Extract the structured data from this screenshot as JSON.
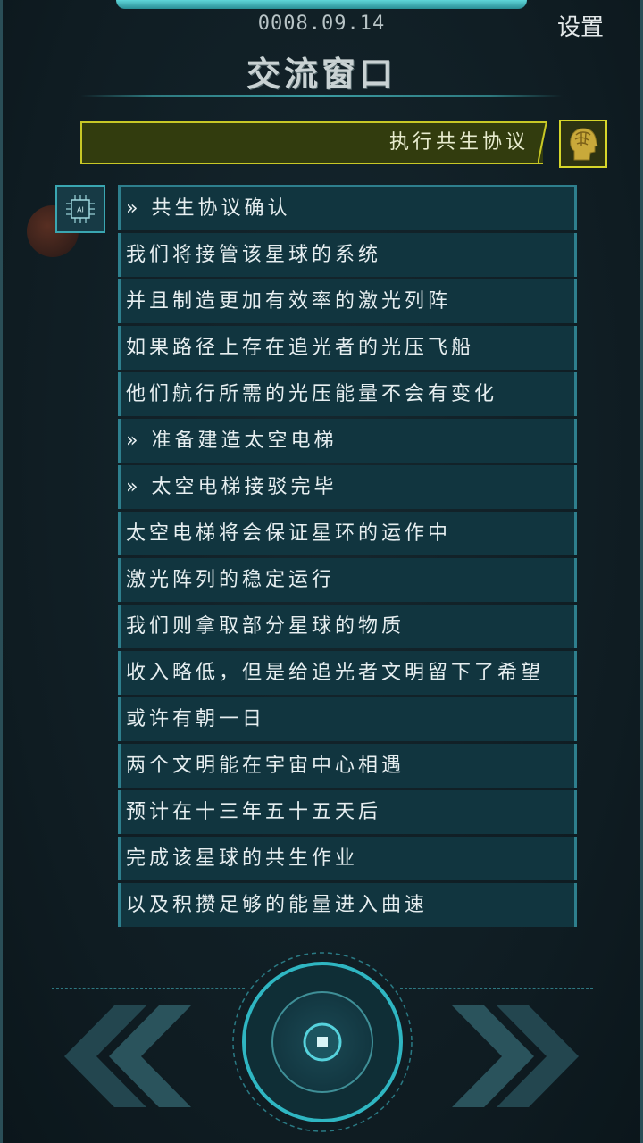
{
  "header": {
    "date": "0008.09.14",
    "settings_label": "设置",
    "title": "交流窗口"
  },
  "player_message": "执行共生协议",
  "ai_avatar_label": "AI",
  "messages": [
    "» 共生协议确认",
    "我们将接管该星球的系统",
    "并且制造更加有效率的激光列阵",
    "如果路径上存在追光者的光压飞船",
    "他们航行所需的光压能量不会有变化",
    "» 准备建造太空电梯",
    "» 太空电梯接驳完毕",
    "太空电梯将会保证星环的运作中",
    "激光阵列的稳定运行",
    "我们则拿取部分星球的物质",
    "收入略低，但是给追光者文明留下了希望",
    "或许有朝一日",
    "两个文明能在宇宙中心相遇",
    "预计在十三年五十五天后",
    "完成该星球的共生作业",
    "以及积攒足够的能量进入曲速"
  ],
  "colors": {
    "background": "#0f1d23",
    "accent_cyan": "#3aa6b1",
    "player_yellow": "#c8c826",
    "message_bg": "#11353f"
  },
  "icons": {
    "player_avatar": "brain-head-icon",
    "ai_avatar": "ai-chip-icon",
    "prev": "double-chevron-left-icon",
    "next": "double-chevron-right-icon",
    "center": "stop-square-icon"
  }
}
